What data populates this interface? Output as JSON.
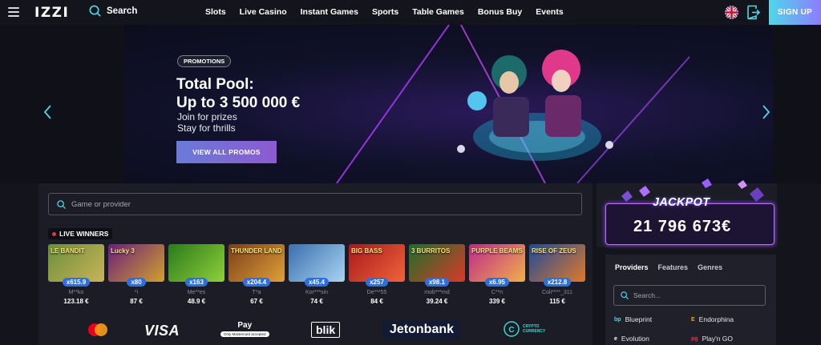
{
  "header": {
    "logo": "IZZI",
    "search_label": "Search",
    "nav": [
      "Slots",
      "Live Casino",
      "Instant Games",
      "Sports",
      "Table Games",
      "Bonus Buy",
      "Events"
    ],
    "signup_label": "SIGN UP"
  },
  "banner": {
    "badge": "PROMOTIONS",
    "title_line1": "Total Pool:",
    "title_line2": "Up to 3 500 000 €",
    "sub_line1": "Join for prizes",
    "sub_line2": "Stay for thrills",
    "button": "VIEW ALL PROMOS"
  },
  "games_search": {
    "placeholder": "Game or provider"
  },
  "live_winners": {
    "label": "LIVE WINNERS",
    "items": [
      {
        "game": "LE BANDIT",
        "multiplier": "x615.9",
        "user": "M**ko",
        "amount": "123.18 €",
        "color1": "#6b8f3a",
        "color2": "#c9b35a"
      },
      {
        "game": "Lucky 3",
        "multiplier": "x80",
        "user": "*i",
        "amount": "87 €",
        "color1": "#6b1f7a",
        "color2": "#d1a12d"
      },
      {
        "game": "",
        "multiplier": "x163",
        "user": "Me**es",
        "amount": "48.9 €",
        "color1": "#2a7a1c",
        "color2": "#8fd03a"
      },
      {
        "game": "THUNDER LAND",
        "multiplier": "x204.4",
        "user": "T*a",
        "amount": "67 €",
        "color1": "#7a3f18",
        "color2": "#e0a03a"
      },
      {
        "game": "",
        "multiplier": "x45.4",
        "user": "Kor***sin",
        "amount": "74 €",
        "color1": "#3a6fb0",
        "color2": "#a9d4f0"
      },
      {
        "game": "BIG BASS",
        "multiplier": "x257",
        "user": "De***55",
        "amount": "84 €",
        "color1": "#a8181c",
        "color2": "#f0643a"
      },
      {
        "game": "3 BURRITOS",
        "multiplier": "x98.1",
        "user": "mob***md",
        "amount": "39.24 €",
        "color1": "#1d6f2b",
        "color2": "#d83a2a"
      },
      {
        "game": "PURPLE BEAMS",
        "multiplier": "x6.95",
        "user": "C**n",
        "amount": "339 €",
        "color1": "#c0288a",
        "color2": "#f0b04a"
      },
      {
        "game": "RISE OF ZEUS",
        "multiplier": "x212.8",
        "user": "Coli****_311",
        "amount": "115 €",
        "color1": "#1c4a9a",
        "color2": "#e07a28"
      }
    ]
  },
  "payments": {
    "visa": "VISA",
    "applepay": "Pay",
    "applepay_note": "Only Mastercard accepted",
    "blik": "blik",
    "jetonbank": "Jetonbank",
    "crypto_line1": "CRYPTO",
    "crypto_line2": "CURRENCY"
  },
  "jackpot": {
    "label": "JACKPOT",
    "value": "21 796 673€"
  },
  "sidebar": {
    "tabs": [
      "Providers",
      "Features",
      "Genres"
    ],
    "search_placeholder": "Search...",
    "providers": [
      {
        "name": "Blueprint",
        "icon": "bp"
      },
      {
        "name": "Endorphina",
        "icon": "E"
      },
      {
        "name": "Evolution",
        "icon": "e"
      },
      {
        "name": "Play'n GO",
        "icon": "pg"
      }
    ]
  },
  "colors": {
    "accent_gradient_start": "#4fd8e8",
    "accent_gradient_end": "#8e7bff",
    "promo_btn_start": "#6a7bd8",
    "promo_btn_end": "#8c5ad2",
    "jackpot_border": "#c26bff",
    "multiplier_badge": "#2c6fe0",
    "live_dot": "#e8344a"
  }
}
